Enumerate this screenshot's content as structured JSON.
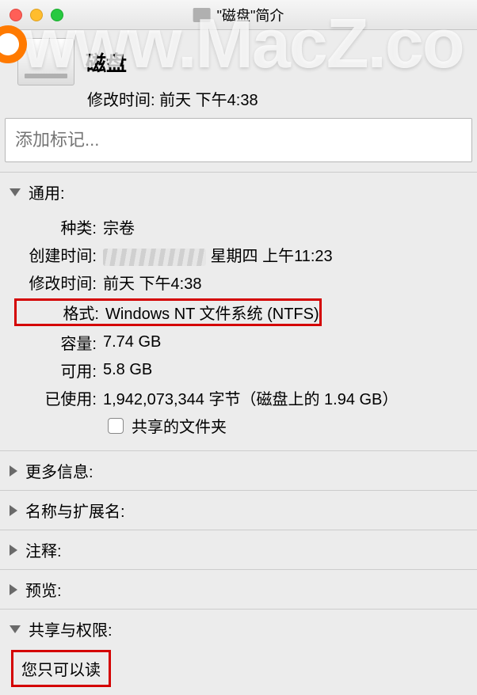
{
  "window": {
    "title": "\"磁盘\"简介"
  },
  "header": {
    "name": "磁盘",
    "modified_label": "修改时间:",
    "modified_value": "前天 下午4:38"
  },
  "tags": {
    "placeholder": "添加标记..."
  },
  "general": {
    "title": "通用:",
    "rows": {
      "kind_label": "种类:",
      "kind_value": "宗卷",
      "created_label": "创建时间:",
      "created_value": "星期四 上午11:23",
      "modified_label": "修改时间:",
      "modified_value": "前天 下午4:38",
      "format_label": "格式:",
      "format_value": "Windows NT 文件系统 (NTFS)",
      "capacity_label": "容量:",
      "capacity_value": "7.74 GB",
      "available_label": "可用:",
      "available_value": "5.8 GB",
      "used_label": "已使用:",
      "used_value": "1,942,073,344 字节（磁盘上的 1.94 GB）",
      "shared_label": "共享的文件夹"
    }
  },
  "sections": {
    "more_info": "更多信息:",
    "name_ext": "名称与扩展名:",
    "comments": "注释:",
    "preview": "预览:",
    "sharing_perms": "共享与权限:"
  },
  "permissions": {
    "message": "您只可以读"
  },
  "watermark": {
    "text": "www.MacZ.co"
  },
  "highlight": {
    "color": "#d40000"
  }
}
